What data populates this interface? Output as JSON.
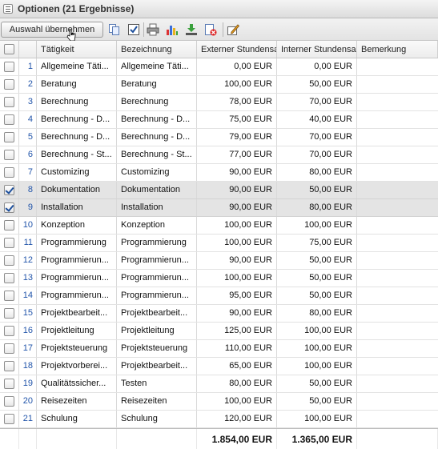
{
  "window": {
    "title": "Optionen (21 Ergebnisse)"
  },
  "toolbar": {
    "take_label": "Auswahl übernehmen",
    "icons": [
      "copy-icon",
      "checkbox-icon",
      "print-icon",
      "chart-icon",
      "export-icon",
      "delete-icon",
      "edit-icon"
    ]
  },
  "table": {
    "headers": [
      "Tätigkeit",
      "Bezeichnung",
      "Externer Stundensa",
      "Interner Stundensa",
      "Bemerkung"
    ],
    "rows": [
      {
        "nr": "1",
        "taetigkeit": "Allgemeine Täti...",
        "bezeichnung": "Allgemeine Täti...",
        "extern": "0,00 EUR",
        "intern": "0,00 EUR",
        "bemerkung": "",
        "checked": false
      },
      {
        "nr": "2",
        "taetigkeit": "Beratung",
        "bezeichnung": "Beratung",
        "extern": "100,00 EUR",
        "intern": "50,00 EUR",
        "bemerkung": "",
        "checked": false
      },
      {
        "nr": "3",
        "taetigkeit": "Berechnung",
        "bezeichnung": "Berechnung",
        "extern": "78,00 EUR",
        "intern": "70,00 EUR",
        "bemerkung": "",
        "checked": false
      },
      {
        "nr": "4",
        "taetigkeit": "Berechnung - D...",
        "bezeichnung": "Berechnung - D...",
        "extern": "75,00 EUR",
        "intern": "40,00 EUR",
        "bemerkung": "",
        "checked": false
      },
      {
        "nr": "5",
        "taetigkeit": "Berechnung - D...",
        "bezeichnung": "Berechnung - D...",
        "extern": "79,00 EUR",
        "intern": "70,00 EUR",
        "bemerkung": "",
        "checked": false
      },
      {
        "nr": "6",
        "taetigkeit": "Berechnung - St...",
        "bezeichnung": "Berechnung - St...",
        "extern": "77,00 EUR",
        "intern": "70,00 EUR",
        "bemerkung": "",
        "checked": false
      },
      {
        "nr": "7",
        "taetigkeit": "Customizing",
        "bezeichnung": "Customizing",
        "extern": "90,00 EUR",
        "intern": "80,00 EUR",
        "bemerkung": "",
        "checked": false
      },
      {
        "nr": "8",
        "taetigkeit": "Dokumentation",
        "bezeichnung": "Dokumentation",
        "extern": "90,00 EUR",
        "intern": "50,00 EUR",
        "bemerkung": "",
        "checked": true
      },
      {
        "nr": "9",
        "taetigkeit": "Installation",
        "bezeichnung": "Installation",
        "extern": "90,00 EUR",
        "intern": "80,00 EUR",
        "bemerkung": "",
        "checked": true
      },
      {
        "nr": "10",
        "taetigkeit": "Konzeption",
        "bezeichnung": "Konzeption",
        "extern": "100,00 EUR",
        "intern": "100,00 EUR",
        "bemerkung": "",
        "checked": false
      },
      {
        "nr": "11",
        "taetigkeit": "Programmierung",
        "bezeichnung": "Programmierung",
        "extern": "100,00 EUR",
        "intern": "75,00 EUR",
        "bemerkung": "",
        "checked": false
      },
      {
        "nr": "12",
        "taetigkeit": "Programmierun...",
        "bezeichnung": "Programmierun...",
        "extern": "90,00 EUR",
        "intern": "50,00 EUR",
        "bemerkung": "",
        "checked": false
      },
      {
        "nr": "13",
        "taetigkeit": "Programmierun...",
        "bezeichnung": "Programmierun...",
        "extern": "100,00 EUR",
        "intern": "50,00 EUR",
        "bemerkung": "",
        "checked": false
      },
      {
        "nr": "14",
        "taetigkeit": "Programmierun...",
        "bezeichnung": "Programmierun...",
        "extern": "95,00 EUR",
        "intern": "50,00 EUR",
        "bemerkung": "",
        "checked": false
      },
      {
        "nr": "15",
        "taetigkeit": "Projektbearbeit...",
        "bezeichnung": "Projektbearbeit...",
        "extern": "90,00 EUR",
        "intern": "80,00 EUR",
        "bemerkung": "",
        "checked": false
      },
      {
        "nr": "16",
        "taetigkeit": "Projektleitung",
        "bezeichnung": "Projektleitung",
        "extern": "125,00 EUR",
        "intern": "100,00 EUR",
        "bemerkung": "",
        "checked": false
      },
      {
        "nr": "17",
        "taetigkeit": "Projektsteuerung",
        "bezeichnung": "Projektsteuerung",
        "extern": "110,00 EUR",
        "intern": "100,00 EUR",
        "bemerkung": "",
        "checked": false
      },
      {
        "nr": "18",
        "taetigkeit": "Projektvorberei...",
        "bezeichnung": "Projektbearbeit...",
        "extern": "65,00 EUR",
        "intern": "100,00 EUR",
        "bemerkung": "",
        "checked": false
      },
      {
        "nr": "19",
        "taetigkeit": "Qualitätssicher...",
        "bezeichnung": "Testen",
        "extern": "80,00 EUR",
        "intern": "50,00 EUR",
        "bemerkung": "",
        "checked": false
      },
      {
        "nr": "20",
        "taetigkeit": "Reisezeiten",
        "bezeichnung": "Reisezeiten",
        "extern": "100,00 EUR",
        "intern": "50,00 EUR",
        "bemerkung": "",
        "checked": false
      },
      {
        "nr": "21",
        "taetigkeit": "Schulung",
        "bezeichnung": "Schulung",
        "extern": "120,00 EUR",
        "intern": "100,00 EUR",
        "bemerkung": "",
        "checked": false
      }
    ],
    "totals": {
      "extern": "1.854,00 EUR",
      "intern": "1.365,00 EUR"
    }
  }
}
